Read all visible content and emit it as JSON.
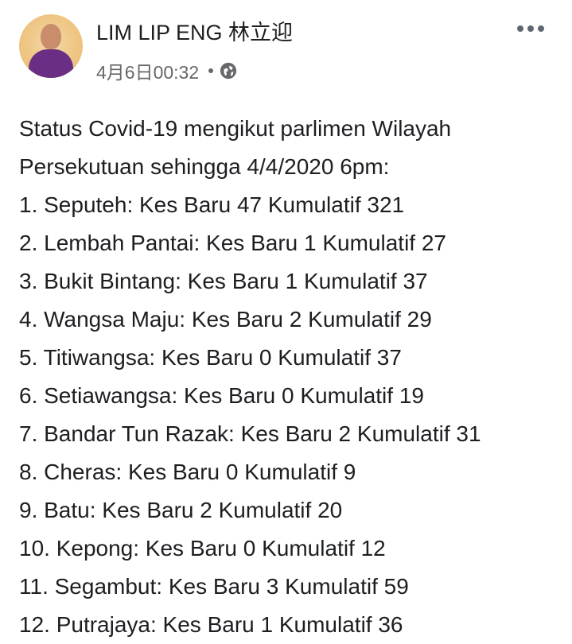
{
  "author": {
    "name": "LIM LIP ENG 林立迎"
  },
  "post": {
    "timestamp": "4月6日00:32",
    "privacy_icon": "globe-icon",
    "more_icon": "more-horizontal-icon",
    "lines": [
      "Status Covid-19 mengikut parlimen Wilayah",
      "Persekutuan sehingga 4/4/2020 6pm:",
      "1. Seputeh: Kes Baru 47 Kumulatif 321",
      "2. Lembah Pantai: Kes Baru 1 Kumulatif 27",
      "3. Bukit Bintang: Kes Baru 1 Kumulatif 37",
      "4. Wangsa Maju: Kes Baru 2 Kumulatif 29",
      "5. Titiwangsa: Kes Baru 0 Kumulatif 37",
      "6. Setiawangsa: Kes Baru 0 Kumulatif 19",
      "7. Bandar Tun Razak: Kes Baru 2 Kumulatif 31",
      "8. Cheras: Kes Baru 0 Kumulatif 9",
      "9. Batu: Kes Baru 2 Kumulatif 20",
      "10. Kepong: Kes Baru 0 Kumulatif 12",
      "11. Segambut: Kes Baru 3 Kumulatif 59",
      "12. Putrajaya: Kes Baru 1 Kumulatif 36"
    ]
  },
  "colors": {
    "text": "#1c1e21",
    "meta": "#65676b",
    "avatar_shirt": "#6a2e84",
    "avatar_bg": "#f0c98a"
  }
}
